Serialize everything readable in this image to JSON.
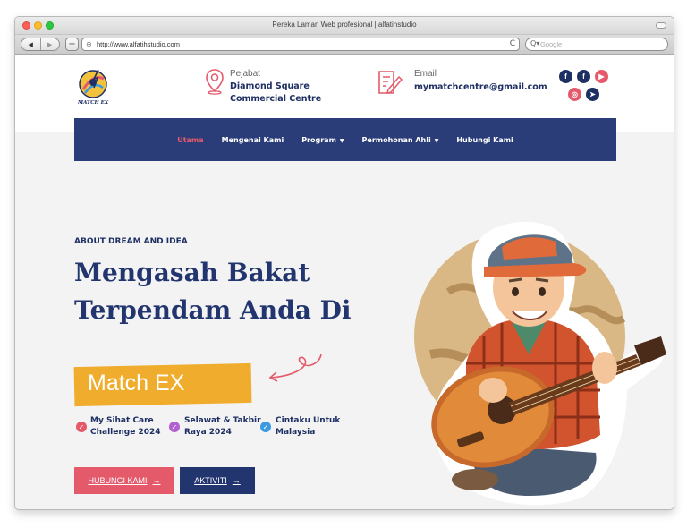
{
  "browser": {
    "window_title": "Pereka Laman Web profesional | alfatihstudio",
    "url": "http://www.alfatihstudio.com",
    "search_placeholder": "Google",
    "back_glyph": "◀",
    "forward_glyph": "▶",
    "new_tab_glyph": "+",
    "reload_glyph": "C"
  },
  "header": {
    "logo_text": "MATCH EX",
    "office": {
      "label": "Pejabat",
      "value": "Diamond Square Commercial Centre",
      "icon": "map-pin-icon"
    },
    "email": {
      "label": "Email",
      "value": "mymatchcentre@gmail.com",
      "icon": "edit-document-icon"
    },
    "social": [
      {
        "name": "facebook",
        "glyph": "f",
        "color": "#1e2f63"
      },
      {
        "name": "facebook",
        "glyph": "f",
        "color": "#1e2f63"
      },
      {
        "name": "youtube",
        "glyph": "▶",
        "color": "#e45a6b"
      },
      {
        "name": "instagram",
        "glyph": "◎",
        "color": "#e45a6b"
      },
      {
        "name": "telegram",
        "glyph": "➤",
        "color": "#1e2f63"
      }
    ]
  },
  "nav": {
    "items": [
      {
        "label": "Utama",
        "active": true,
        "dropdown": false
      },
      {
        "label": "Mengenai Kami",
        "active": false,
        "dropdown": false
      },
      {
        "label": "Program",
        "active": false,
        "dropdown": true
      },
      {
        "label": "Permohonan Ahli",
        "active": false,
        "dropdown": true
      },
      {
        "label": "Hubungi Kami",
        "active": false,
        "dropdown": false
      }
    ],
    "caret": "▼"
  },
  "hero": {
    "eyebrow": "ABOUT DREAM AND IDEA",
    "headline": "Mengasah Bakat Terpendam Anda Di",
    "highlight": "Match EX",
    "checks": [
      {
        "label": "My Sihat Care Challenge 2024",
        "color": "#e45a6b"
      },
      {
        "label": "Selawat & Takbir Raya 2024",
        "color": "#b25fd0"
      },
      {
        "label": "Cintaku Untuk Malaysia",
        "color": "#3b9be0"
      }
    ],
    "check_glyph": "✓",
    "buttons": {
      "contact": "HUBUNGI KAMI",
      "activity": "AKTIVITI",
      "arrow": "→"
    }
  },
  "colors": {
    "navy": "#23356f",
    "coral": "#e45a6b",
    "gold": "#f0ac2c",
    "nav_bg": "#2b3d78"
  }
}
